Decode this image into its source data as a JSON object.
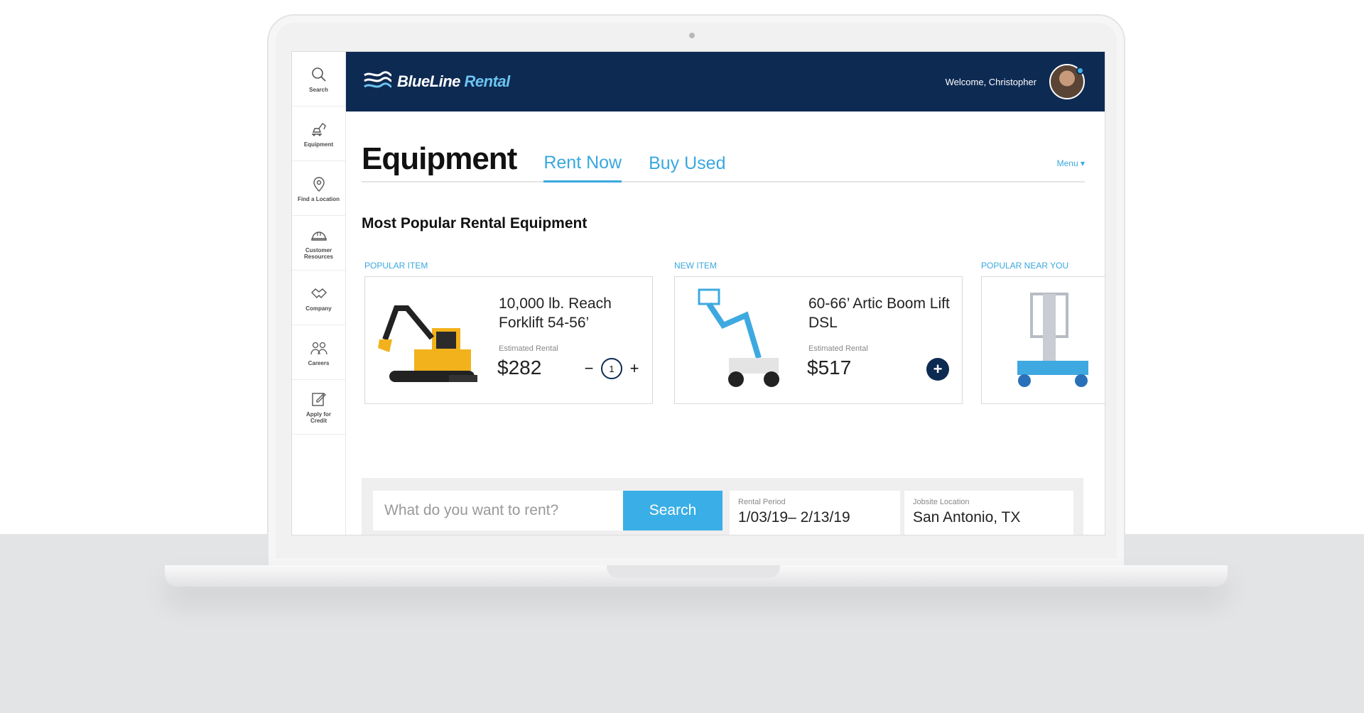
{
  "sidebar": {
    "items": [
      {
        "label": "Search",
        "icon": "search-icon"
      },
      {
        "label": "Equipment",
        "icon": "excavator-icon"
      },
      {
        "label": "Find a Location",
        "icon": "map-pin-icon"
      },
      {
        "label": "Customer Resources",
        "icon": "hardhat-icon"
      },
      {
        "label": "Company",
        "icon": "handshake-icon"
      },
      {
        "label": "Careers",
        "icon": "people-icon"
      },
      {
        "label": "Apply for Credit",
        "icon": "edit-form-icon"
      }
    ]
  },
  "header": {
    "logo_main": "BlueLine",
    "logo_accent": "Rental",
    "welcome": "Welcome, Christopher"
  },
  "page": {
    "title": "Equipment",
    "tabs": [
      {
        "label": "Rent Now",
        "active": true
      },
      {
        "label": "Buy Used",
        "active": false
      }
    ],
    "menu_label": "Menu ▾",
    "section_title": "Most Popular Rental Equipment"
  },
  "cards": [
    {
      "tag": "POPULAR ITEM",
      "name": "10,000 lb. Reach Forklift 54-56’",
      "est_label": "Estimated Rental",
      "price": "$282",
      "quantity": "1",
      "minus": "−",
      "plus": "+"
    },
    {
      "tag": "NEW ITEM",
      "name": "60-66’ Artic Boom Lift DSL",
      "est_label": "Estimated Rental",
      "price": "$517",
      "add": "+"
    },
    {
      "tag": "POPULAR NEAR YOU"
    }
  ],
  "search": {
    "placeholder": "What do you want to rent?",
    "button_label": "Search",
    "rental_period_label": "Rental Period",
    "rental_period_value": "1/03/19– 2/13/19",
    "jobsite_label": "Jobsite Location",
    "jobsite_value": "San Antonio, TX"
  },
  "colors": {
    "navy": "#0d2a52",
    "accent_blue": "#3aa8df",
    "excavator_yellow": "#f2b21c",
    "lift_blue": "#3ea9e0"
  }
}
